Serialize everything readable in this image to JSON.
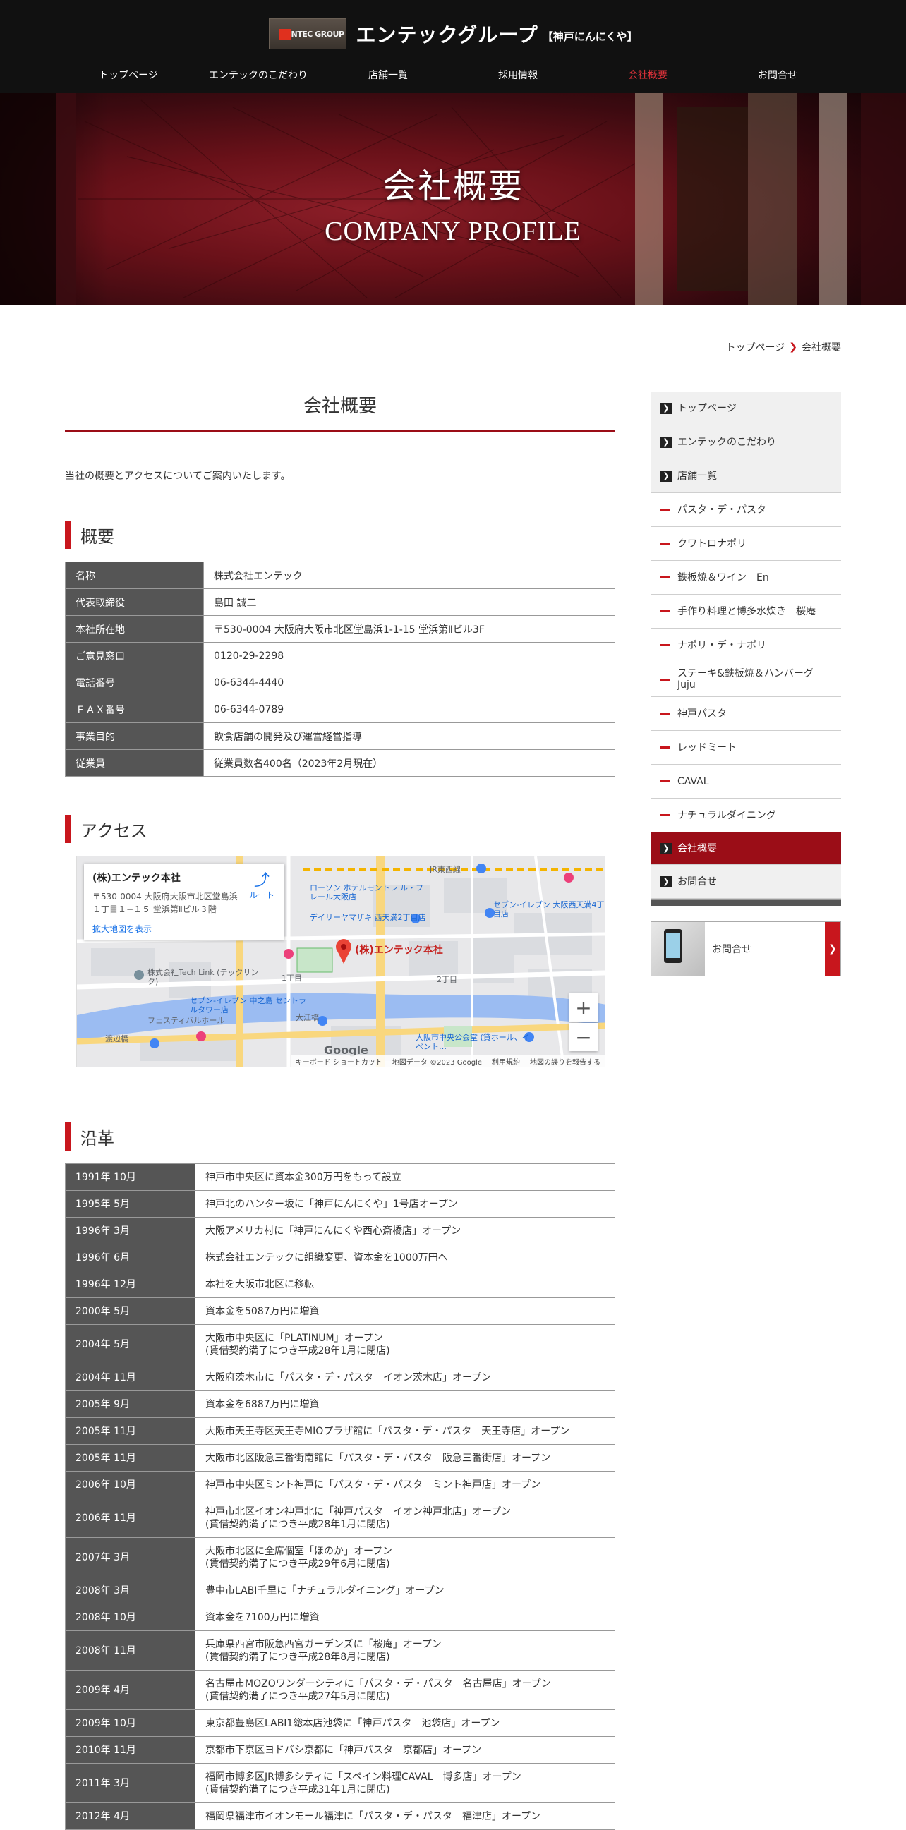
{
  "header": {
    "logo_text": "ENTEC GROUP",
    "site_title": "エンテックグループ",
    "site_sub": "【神戸にんにくや】"
  },
  "nav": [
    {
      "label": "トップページ",
      "active": false
    },
    {
      "label": "エンテックのこだわり",
      "active": false
    },
    {
      "label": "店舗一覧",
      "active": false
    },
    {
      "label": "採用情報",
      "active": false
    },
    {
      "label": "会社概要",
      "active": true
    },
    {
      "label": "お問合せ",
      "active": false
    }
  ],
  "hero": {
    "title": "会社概要",
    "subtitle": "COMPANY PROFILE"
  },
  "breadcrumb": {
    "home": "トップページ",
    "current": "会社概要"
  },
  "main": {
    "page_title": "会社概要",
    "intro": "当社の概要とアクセスについてご案内いたします。",
    "overview_heading": "概要",
    "overview": [
      {
        "label": "名称",
        "value": "株式会社エンテック"
      },
      {
        "label": "代表取締役",
        "value": "島田 誠二"
      },
      {
        "label": "本社所在地",
        "value": "〒530-0004 大阪府大阪市北区堂島浜1-1-15 堂浜第Ⅱビル3F"
      },
      {
        "label": "ご意見窓口",
        "value": "0120-29-2298"
      },
      {
        "label": "電話番号",
        "value": "06-6344-4440"
      },
      {
        "label": "ＦＡＸ番号",
        "value": "06-6344-0789"
      },
      {
        "label": "事業目的",
        "value": "飲食店舗の開発及び運営経営指導"
      },
      {
        "label": "従業員",
        "value": "従業員数名400名（2023年2月現在）"
      }
    ],
    "access_heading": "アクセス",
    "map": {
      "place_name": "(株)エンテック本社",
      "address": "〒530-0004 大阪府大阪市北区堂島浜１丁目１−１５ 堂浜第Ⅱビル３階",
      "large_map_link": "拡大地図を表示",
      "route_label": "ルート",
      "pin_label": "(株)エンテック本社",
      "zoom_in": "+",
      "zoom_out": "−",
      "google": "Google",
      "footer_shortcuts": "キーボード ショートカット",
      "footer_data": "地図データ ©2023 Google",
      "footer_terms": "利用規約",
      "footer_report": "地図の誤りを報告する",
      "labels": [
        "ローソン ホテルモントレ ル・フレール大阪店",
        "セブン-イレブン 大阪西天満4丁目店",
        "デイリーヤマザキ 西天満2丁目店",
        "株式会社Tech Link (テックリンク)",
        "セブン-イレブン 中之島 セントラルタワー店",
        "フェスティバルホール",
        "大阪市中央公会堂 (貸ホール、イベント…",
        "大江橋",
        "渡辺橋",
        "JR東西線",
        "2丁目",
        "1丁目"
      ]
    },
    "history_heading": "沿革",
    "history": [
      {
        "date": "1991年 10月",
        "lines": [
          "神戸市中央区に資本金300万円をもって設立"
        ]
      },
      {
        "date": "1995年 5月",
        "lines": [
          "神戸北のハンター坂に「神戸にんにくや」1号店オープン"
        ]
      },
      {
        "date": "1996年 3月",
        "lines": [
          "大阪アメリカ村に「神戸にんにくや西心斎橋店」オープン"
        ]
      },
      {
        "date": "1996年 6月",
        "lines": [
          "株式会社エンテックに組織変更、資本金を1000万円へ"
        ]
      },
      {
        "date": "1996年 12月",
        "lines": [
          "本社を大阪市北区に移転"
        ]
      },
      {
        "date": "2000年 5月",
        "lines": [
          "資本金を5087万円に増資"
        ]
      },
      {
        "date": "2004年 5月",
        "lines": [
          "大阪市中央区に「PLATINUM」オープン",
          "(賃借契約満了につき平成28年1月に閉店)"
        ]
      },
      {
        "date": "2004年 11月",
        "lines": [
          "大阪府茨木市に「パスタ・デ・パスタ　イオン茨木店」オープン"
        ]
      },
      {
        "date": "2005年 9月",
        "lines": [
          "資本金を6887万円に増資"
        ]
      },
      {
        "date": "2005年 11月",
        "lines": [
          "大阪市天王寺区天王寺MIOプラザ館に「パスタ・デ・パスタ　天王寺店」オープン"
        ]
      },
      {
        "date": "2005年 11月",
        "lines": [
          "大阪市北区阪急三番街南館に「パスタ・デ・パスタ　阪急三番街店」オープン"
        ]
      },
      {
        "date": "2006年 10月",
        "lines": [
          "神戸市中央区ミント神戸に「パスタ・デ・パスタ　ミント神戸店」オープン"
        ]
      },
      {
        "date": "2006年 11月",
        "lines": [
          "神戸市北区イオン神戸北に「神戸パスタ　イオン神戸北店」オープン",
          "(賃借契約満了につき平成28年1月に閉店)"
        ]
      },
      {
        "date": "2007年 3月",
        "lines": [
          "大阪市北区に全席個室「ほのか」オープン",
          "(賃借契約満了につき平成29年6月に閉店)"
        ]
      },
      {
        "date": "2008年 3月",
        "lines": [
          "豊中市LABI千里に「ナチュラルダイニング」オープン"
        ]
      },
      {
        "date": "2008年 10月",
        "lines": [
          "資本金を7100万円に増資"
        ]
      },
      {
        "date": "2008年 11月",
        "lines": [
          "兵庫県西宮市阪急西宮ガーデンズに「桜庵」オープン",
          "(賃借契約満了につき平成28年8月に閉店)"
        ]
      },
      {
        "date": "2009年 4月",
        "lines": [
          "名古屋市MOZOワンダーシティに「パスタ・デ・パスタ　名古屋店」オープン",
          "(賃借契約満了につき平成27年5月に閉店)"
        ]
      },
      {
        "date": "2009年 10月",
        "lines": [
          "東京都豊島区LABI1総本店池袋に「神戸パスタ　池袋店」オープン"
        ]
      },
      {
        "date": "2010年 11月",
        "lines": [
          "京都市下京区ヨドバシ京都に「神戸パスタ　京都店」オープン"
        ]
      },
      {
        "date": "2011年 3月",
        "lines": [
          "福岡市博多区JR博多シティに「スペイン料理CAVAL　博多店」オープン",
          "(賃借契約満了につき平成31年1月に閉店)"
        ]
      },
      {
        "date": "2012年 4月",
        "lines": [
          "福岡県福津市イオンモール福津に「パスタ・デ・パスタ　福津店」オープン"
        ]
      }
    ]
  },
  "sidebar": {
    "items": [
      {
        "label": "トップページ",
        "type": "main"
      },
      {
        "label": "エンテックのこだわり",
        "type": "main"
      },
      {
        "label": "店舗一覧",
        "type": "main"
      },
      {
        "label": "パスタ・デ・パスタ",
        "type": "sub"
      },
      {
        "label": "クワトロナポリ",
        "type": "sub"
      },
      {
        "label": "鉄板焼＆ワイン　En",
        "type": "sub"
      },
      {
        "label": "手作り料理と博多水炊き　桜庵",
        "type": "sub"
      },
      {
        "label": "ナポリ・デ・ナポリ",
        "type": "sub"
      },
      {
        "label": "ステーキ&鉄板焼＆ハンバーグ Juju",
        "type": "sub"
      },
      {
        "label": "神戸パスタ",
        "type": "sub"
      },
      {
        "label": "レッドミート",
        "type": "sub"
      },
      {
        "label": "CAVAL",
        "type": "sub"
      },
      {
        "label": "ナチュラルダイニング",
        "type": "sub"
      },
      {
        "label": "会社概要",
        "type": "active"
      },
      {
        "label": "お問合せ",
        "type": "main"
      }
    ],
    "contact_label": "お問合せ"
  },
  "colors": {
    "accent": "#c8161d",
    "dark_red": "#9b0d17",
    "header_bg": "#111111",
    "table_header": "#555555"
  }
}
